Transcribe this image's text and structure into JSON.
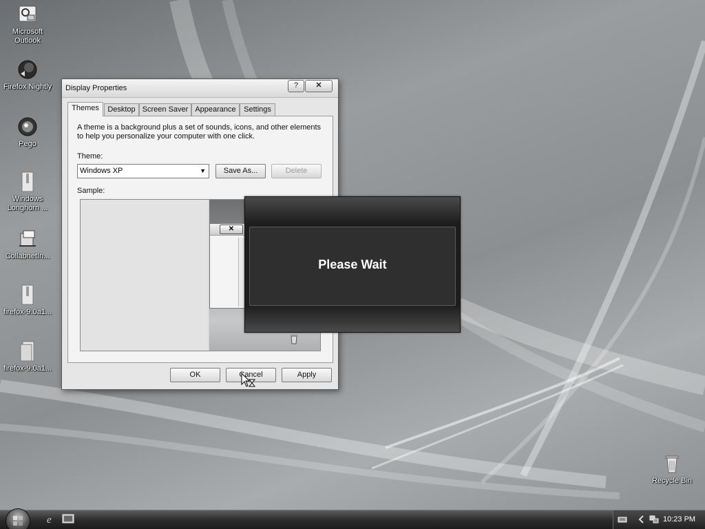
{
  "desktop": {
    "icons": [
      {
        "label": "Microsoft Outlook",
        "icon": "outlook-icon"
      },
      {
        "label": "Firefox Nightly",
        "icon": "firefox-nightly-icon"
      },
      {
        "label": "Pego",
        "icon": "pego-icon"
      },
      {
        "label": "Windows Longhorn ...",
        "icon": "zip-folder-icon"
      },
      {
        "label": "CollabnetIn...",
        "icon": "installer-icon"
      },
      {
        "label": "firefox-9.0a1...",
        "icon": "zip-folder-icon"
      },
      {
        "label": "firefox-9.0a1...",
        "icon": "folder-icon"
      },
      {
        "label": "Recycle Bin",
        "icon": "recycle-bin-icon"
      }
    ]
  },
  "window": {
    "title": "Display Properties",
    "help_label": "?",
    "close_label": "✕",
    "tabs": [
      {
        "label": "Themes",
        "active": true
      },
      {
        "label": "Desktop",
        "active": false
      },
      {
        "label": "Screen Saver",
        "active": false
      },
      {
        "label": "Appearance",
        "active": false
      },
      {
        "label": "Settings",
        "active": false
      }
    ],
    "description": "A theme is a background plus a set of sounds, icons, and other elements to help you personalize your computer with one click.",
    "theme_label": "Theme:",
    "theme_value": "Windows XP",
    "save_as_label": "Save As...",
    "delete_label": "Delete",
    "sample_label": "Sample:",
    "preview_close": "✕",
    "ok_label": "OK",
    "cancel_label": "Cancel",
    "apply_label": "Apply"
  },
  "overlay": {
    "message": "Please Wait"
  },
  "taskbar": {
    "clock": "10:23 PM",
    "quick_launch": [
      "internet-explorer-icon",
      "show-desktop-icon"
    ],
    "tray": [
      "keyboard-icon",
      "chevron-left-icon",
      "network-icon"
    ]
  },
  "colors": {
    "overlay_bg": "#1d1d1d",
    "window_bg": "#e6e6e6",
    "taskbar_bg": "#2c2c2c"
  }
}
